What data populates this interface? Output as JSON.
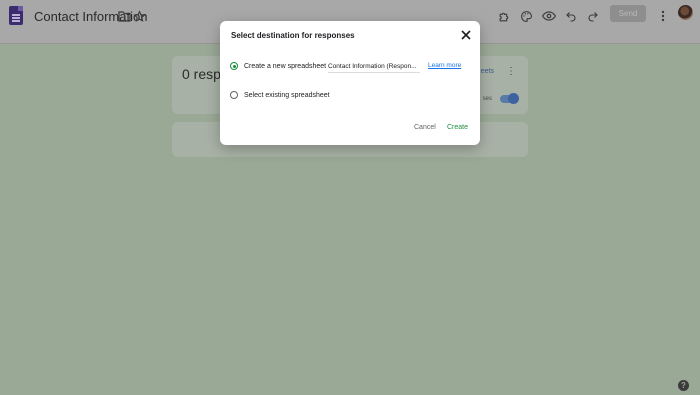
{
  "header": {
    "doc_title": "Contact Information",
    "send_label": "Send",
    "icons": [
      "forms-logo-icon",
      "folder-icon",
      "star-icon",
      "addon-icon",
      "palette-icon",
      "preview-eye-icon",
      "undo-icon",
      "redo-icon",
      "more-vert-icon",
      "avatar"
    ]
  },
  "responses_card": {
    "count_text": "0 resp",
    "sheets_link": "eets",
    "accepting_label": "ses"
  },
  "dialog": {
    "title": "Select destination for responses",
    "option_new": "Create a new spreadsheet",
    "spreadsheet_name": "Contact Information (Respon...",
    "learn_more": "Learn more",
    "option_existing": "Select existing spreadsheet",
    "cancel_label": "Cancel",
    "create_label": "Create"
  },
  "colors": {
    "accent_green": "#1e8e3e",
    "link_blue": "#1a73e8"
  },
  "help_icon": "?"
}
